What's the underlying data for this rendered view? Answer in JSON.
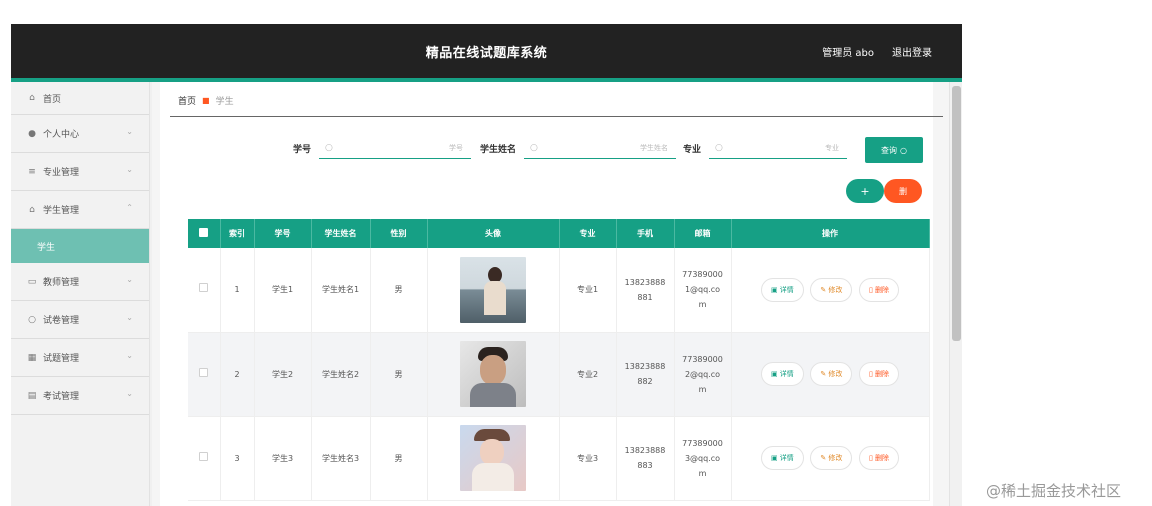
{
  "header": {
    "title": "精品在线试题库系统",
    "user": "管理员 abo",
    "logout": "退出登录"
  },
  "sidebar": {
    "home": "首页",
    "items": [
      {
        "label": "个人中心",
        "icon": "user-icon"
      },
      {
        "label": "专业管理",
        "icon": "list-icon"
      },
      {
        "label": "学生管理",
        "icon": "bank-icon",
        "expanded": true
      },
      {
        "label": "教师管理",
        "icon": "message-icon"
      },
      {
        "label": "试卷管理",
        "icon": "circle-icon"
      },
      {
        "label": "试题管理",
        "icon": "grid-icon"
      },
      {
        "label": "考试管理",
        "icon": "table-icon"
      }
    ],
    "active_sub": "学生"
  },
  "breadcrumb": {
    "home": "首页",
    "current": "学生"
  },
  "search": {
    "fields": [
      {
        "label": "学号",
        "placeholder": "学号"
      },
      {
        "label": "学生姓名",
        "placeholder": "学生姓名"
      },
      {
        "label": "专业",
        "placeholder": "专业"
      }
    ],
    "query_label": "查询"
  },
  "actions": {
    "add": "+",
    "delete": "删"
  },
  "table": {
    "headers": [
      "",
      "索引",
      "学号",
      "学生姓名",
      "性别",
      "头像",
      "专业",
      "手机",
      "邮箱",
      "操作"
    ],
    "rows": [
      {
        "index": "1",
        "id": "学生1",
        "name": "学生姓名1",
        "gender": "男",
        "major": "专业1",
        "phone": [
          "13823888",
          "881"
        ],
        "email": [
          "77389000",
          "1@qq.co",
          "m"
        ]
      },
      {
        "index": "2",
        "id": "学生2",
        "name": "学生姓名2",
        "gender": "男",
        "major": "专业2",
        "phone": [
          "13823888",
          "882"
        ],
        "email": [
          "77389000",
          "2@qq.co",
          "m"
        ]
      },
      {
        "index": "3",
        "id": "学生3",
        "name": "学生姓名3",
        "gender": "男",
        "major": "专业3",
        "phone": [
          "13823888",
          "883"
        ],
        "email": [
          "77389000",
          "3@qq.co",
          "m"
        ]
      }
    ],
    "row_actions": {
      "detail": "详情",
      "edit": "修改",
      "delete": "删除"
    }
  },
  "watermark": "@稀土掘金技术社区",
  "colors": {
    "accent": "#16a085",
    "danger": "#ff5722",
    "header_bg": "#222222"
  }
}
